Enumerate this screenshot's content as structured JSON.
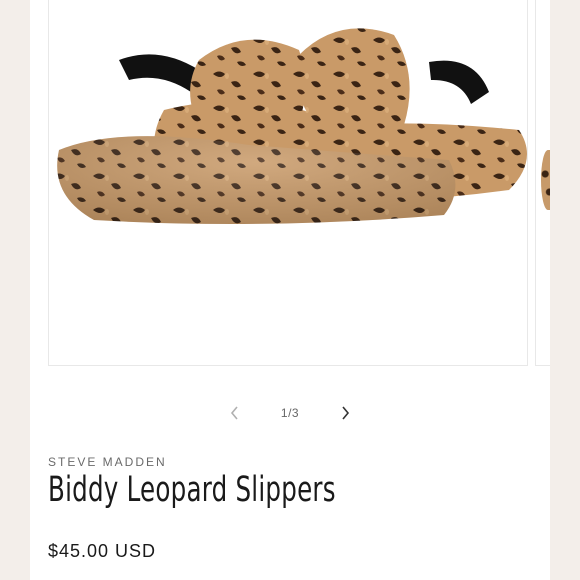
{
  "gallery": {
    "image_alt": "Leopard print faux-fur slingback slippers",
    "counter": "1/3",
    "prev_icon": "chevron-left-icon",
    "next_icon": "chevron-right-icon"
  },
  "product": {
    "vendor": "STEVE MADDEN",
    "title": "Biddy Leopard Slippers",
    "price": "$45.00 USD"
  },
  "colors": {
    "background": "#f3eeea",
    "card": "#ffffff",
    "fur": "#c99a68",
    "spots": "#3a2414",
    "strap": "#111111"
  }
}
